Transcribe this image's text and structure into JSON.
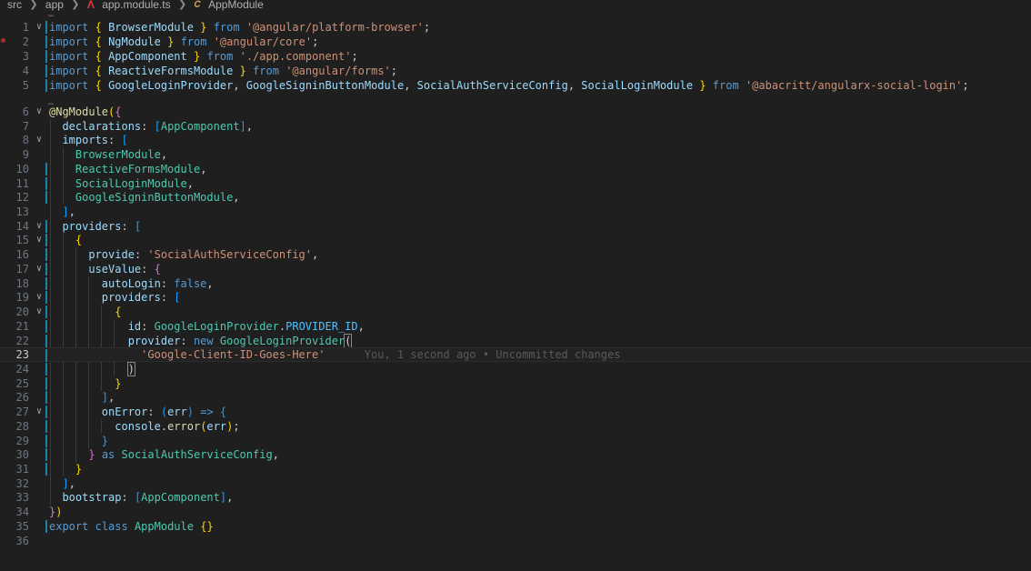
{
  "breadcrumb": {
    "segments": [
      "src",
      "app",
      "app.module.ts",
      "AppModule"
    ],
    "icons": [
      "angular-icon",
      "symbol-class-icon"
    ]
  },
  "editor": {
    "current_line": 23,
    "blame": "You, 1 second ago • Uncommitted changes",
    "lines": [
      {
        "n": 1,
        "fold": true,
        "mod": true,
        "tokens": [
          [
            "kw",
            "import"
          ],
          [
            "pun",
            " "
          ],
          [
            "br1",
            "{"
          ],
          [
            "pun",
            " "
          ],
          [
            "var",
            "BrowserModule"
          ],
          [
            "pun",
            " "
          ],
          [
            "br1",
            "}"
          ],
          [
            "pun",
            " "
          ],
          [
            "kw",
            "from"
          ],
          [
            "pun",
            " "
          ],
          [
            "str",
            "'@angular/platform-browser'"
          ],
          [
            "pun",
            ";"
          ]
        ]
      },
      {
        "n": 2,
        "fold": false,
        "mod": true,
        "tokens": [
          [
            "kw",
            "import"
          ],
          [
            "pun",
            " "
          ],
          [
            "br1",
            "{"
          ],
          [
            "pun",
            " "
          ],
          [
            "var",
            "NgModule"
          ],
          [
            "pun",
            " "
          ],
          [
            "br1",
            "}"
          ],
          [
            "pun",
            " "
          ],
          [
            "kw",
            "from"
          ],
          [
            "pun",
            " "
          ],
          [
            "str",
            "'@angular/core'"
          ],
          [
            "pun",
            ";"
          ]
        ]
      },
      {
        "n": 3,
        "fold": false,
        "mod": true,
        "tokens": [
          [
            "kw",
            "import"
          ],
          [
            "pun",
            " "
          ],
          [
            "br1",
            "{"
          ],
          [
            "pun",
            " "
          ],
          [
            "var",
            "AppComponent"
          ],
          [
            "pun",
            " "
          ],
          [
            "br1",
            "}"
          ],
          [
            "pun",
            " "
          ],
          [
            "kw",
            "from"
          ],
          [
            "pun",
            " "
          ],
          [
            "str",
            "'./app.component'"
          ],
          [
            "pun",
            ";"
          ]
        ]
      },
      {
        "n": 4,
        "fold": false,
        "mod": true,
        "tokens": [
          [
            "kw",
            "import"
          ],
          [
            "pun",
            " "
          ],
          [
            "br1",
            "{"
          ],
          [
            "pun",
            " "
          ],
          [
            "var",
            "ReactiveFormsModule"
          ],
          [
            "pun",
            " "
          ],
          [
            "br1",
            "}"
          ],
          [
            "pun",
            " "
          ],
          [
            "kw",
            "from"
          ],
          [
            "pun",
            " "
          ],
          [
            "str",
            "'@angular/forms'"
          ],
          [
            "pun",
            ";"
          ]
        ]
      },
      {
        "n": 5,
        "fold": false,
        "mod": true,
        "tokens": [
          [
            "kw",
            "import"
          ],
          [
            "pun",
            " "
          ],
          [
            "br1",
            "{"
          ],
          [
            "pun",
            " "
          ],
          [
            "var",
            "GoogleLoginProvider"
          ],
          [
            "pun",
            ", "
          ],
          [
            "var",
            "GoogleSigninButtonModule"
          ],
          [
            "pun",
            ", "
          ],
          [
            "var",
            "SocialAuthServiceConfig"
          ],
          [
            "pun",
            ", "
          ],
          [
            "var",
            "SocialLoginModule"
          ],
          [
            "pun",
            " "
          ],
          [
            "br1",
            "}"
          ],
          [
            "pun",
            " "
          ],
          [
            "kw",
            "from"
          ],
          [
            "pun",
            " "
          ],
          [
            "str",
            "'@abacritt/angularx-social-login'"
          ],
          [
            "pun",
            ";"
          ]
        ]
      },
      {
        "n": 6,
        "fold": true,
        "mod": false,
        "tokens": [
          [
            "fn",
            "@NgModule"
          ],
          [
            "br1",
            "("
          ],
          [
            "br2",
            "{"
          ]
        ]
      },
      {
        "n": 7,
        "fold": false,
        "mod": false,
        "tokens": [
          [
            "pun",
            "  "
          ],
          [
            "var",
            "declarations"
          ],
          [
            "pun",
            ": "
          ],
          [
            "br3",
            "["
          ],
          [
            "type",
            "AppComponent"
          ],
          [
            "br3",
            "]"
          ],
          [
            "pun",
            ","
          ]
        ]
      },
      {
        "n": 8,
        "fold": true,
        "mod": false,
        "tokens": [
          [
            "pun",
            "  "
          ],
          [
            "var",
            "imports"
          ],
          [
            "pun",
            ": "
          ],
          [
            "br3",
            "["
          ]
        ]
      },
      {
        "n": 9,
        "fold": false,
        "mod": false,
        "tokens": [
          [
            "pun",
            "    "
          ],
          [
            "type",
            "BrowserModule"
          ],
          [
            "pun",
            ","
          ]
        ]
      },
      {
        "n": 10,
        "fold": false,
        "mod": true,
        "tokens": [
          [
            "pun",
            "    "
          ],
          [
            "type",
            "ReactiveFormsModule"
          ],
          [
            "pun",
            ","
          ]
        ]
      },
      {
        "n": 11,
        "fold": false,
        "mod": true,
        "tokens": [
          [
            "pun",
            "    "
          ],
          [
            "type",
            "SocialLoginModule"
          ],
          [
            "pun",
            ","
          ]
        ]
      },
      {
        "n": 12,
        "fold": false,
        "mod": true,
        "tokens": [
          [
            "pun",
            "    "
          ],
          [
            "type",
            "GoogleSigninButtonModule"
          ],
          [
            "pun",
            ","
          ]
        ]
      },
      {
        "n": 13,
        "fold": false,
        "mod": false,
        "tokens": [
          [
            "pun",
            "  "
          ],
          [
            "br3",
            "]"
          ],
          [
            "pun",
            ","
          ]
        ]
      },
      {
        "n": 14,
        "fold": true,
        "mod": true,
        "tokens": [
          [
            "pun",
            "  "
          ],
          [
            "var",
            "providers"
          ],
          [
            "pun",
            ": "
          ],
          [
            "br3",
            "["
          ]
        ]
      },
      {
        "n": 15,
        "fold": true,
        "mod": true,
        "tokens": [
          [
            "pun",
            "    "
          ],
          [
            "br1",
            "{"
          ]
        ]
      },
      {
        "n": 16,
        "fold": false,
        "mod": true,
        "tokens": [
          [
            "pun",
            "      "
          ],
          [
            "var",
            "provide"
          ],
          [
            "pun",
            ": "
          ],
          [
            "str",
            "'SocialAuthServiceConfig'"
          ],
          [
            "pun",
            ","
          ]
        ]
      },
      {
        "n": 17,
        "fold": true,
        "mod": true,
        "tokens": [
          [
            "pun",
            "      "
          ],
          [
            "var",
            "useValue"
          ],
          [
            "pun",
            ": "
          ],
          [
            "br2",
            "{"
          ]
        ]
      },
      {
        "n": 18,
        "fold": false,
        "mod": true,
        "tokens": [
          [
            "pun",
            "        "
          ],
          [
            "var",
            "autoLogin"
          ],
          [
            "pun",
            ": "
          ],
          [
            "kw",
            "false"
          ],
          [
            "pun",
            ","
          ]
        ]
      },
      {
        "n": 19,
        "fold": true,
        "mod": true,
        "tokens": [
          [
            "pun",
            "        "
          ],
          [
            "var",
            "providers"
          ],
          [
            "pun",
            ": "
          ],
          [
            "br3",
            "["
          ]
        ]
      },
      {
        "n": 20,
        "fold": true,
        "mod": true,
        "tokens": [
          [
            "pun",
            "          "
          ],
          [
            "br1",
            "{"
          ]
        ]
      },
      {
        "n": 21,
        "fold": false,
        "mod": true,
        "tokens": [
          [
            "pun",
            "            "
          ],
          [
            "var",
            "id"
          ],
          [
            "pun",
            ": "
          ],
          [
            "type",
            "GoogleLoginProvider"
          ],
          [
            "pun",
            "."
          ],
          [
            "const",
            "PROVIDER_ID"
          ],
          [
            "pun",
            ","
          ]
        ]
      },
      {
        "n": 22,
        "fold": false,
        "mod": true,
        "tokens": [
          [
            "pun",
            "            "
          ],
          [
            "var",
            "provider"
          ],
          [
            "pun",
            ": "
          ],
          [
            "kw",
            "new"
          ],
          [
            "pun",
            " "
          ],
          [
            "type",
            "GoogleLoginProvider"
          ],
          [
            "box",
            "("
          ]
        ]
      },
      {
        "n": 23,
        "fold": false,
        "mod": true,
        "tokens": [
          [
            "pun",
            "              "
          ],
          [
            "str",
            "'Google-Client-ID-Goes-Here'"
          ]
        ]
      },
      {
        "n": 24,
        "fold": false,
        "mod": true,
        "tokens": [
          [
            "pun",
            "            "
          ],
          [
            "box",
            ")"
          ]
        ]
      },
      {
        "n": 25,
        "fold": false,
        "mod": true,
        "tokens": [
          [
            "pun",
            "          "
          ],
          [
            "br1",
            "}"
          ]
        ]
      },
      {
        "n": 26,
        "fold": false,
        "mod": true,
        "tokens": [
          [
            "pun",
            "        "
          ],
          [
            "br3",
            "]"
          ],
          [
            "pun",
            ","
          ]
        ]
      },
      {
        "n": 27,
        "fold": true,
        "mod": true,
        "tokens": [
          [
            "pun",
            "        "
          ],
          [
            "var",
            "onError"
          ],
          [
            "pun",
            ": "
          ],
          [
            "br3",
            "("
          ],
          [
            "var",
            "err"
          ],
          [
            "br3",
            ")"
          ],
          [
            "pun",
            " "
          ],
          [
            "kw",
            "=>"
          ],
          [
            "pun",
            " "
          ],
          [
            "br3",
            "{"
          ]
        ]
      },
      {
        "n": 28,
        "fold": false,
        "mod": true,
        "tokens": [
          [
            "pun",
            "          "
          ],
          [
            "var",
            "console"
          ],
          [
            "pun",
            "."
          ],
          [
            "fn",
            "error"
          ],
          [
            "br1",
            "("
          ],
          [
            "var",
            "err"
          ],
          [
            "br1",
            ")"
          ],
          [
            "pun",
            ";"
          ]
        ]
      },
      {
        "n": 29,
        "fold": false,
        "mod": true,
        "tokens": [
          [
            "pun",
            "        "
          ],
          [
            "br3",
            "}"
          ]
        ]
      },
      {
        "n": 30,
        "fold": false,
        "mod": true,
        "tokens": [
          [
            "pun",
            "      "
          ],
          [
            "br2",
            "}"
          ],
          [
            "pun",
            " "
          ],
          [
            "kw",
            "as"
          ],
          [
            "pun",
            " "
          ],
          [
            "type",
            "SocialAuthServiceConfig"
          ],
          [
            "pun",
            ","
          ]
        ]
      },
      {
        "n": 31,
        "fold": false,
        "mod": true,
        "tokens": [
          [
            "pun",
            "    "
          ],
          [
            "br1",
            "}"
          ]
        ]
      },
      {
        "n": 32,
        "fold": false,
        "mod": false,
        "tokens": [
          [
            "pun",
            "  "
          ],
          [
            "br3",
            "]"
          ],
          [
            "pun",
            ","
          ]
        ]
      },
      {
        "n": 33,
        "fold": false,
        "mod": false,
        "tokens": [
          [
            "pun",
            "  "
          ],
          [
            "var",
            "bootstrap"
          ],
          [
            "pun",
            ": "
          ],
          [
            "br3",
            "["
          ],
          [
            "type",
            "AppComponent"
          ],
          [
            "br3",
            "]"
          ],
          [
            "pun",
            ","
          ]
        ]
      },
      {
        "n": 34,
        "fold": false,
        "mod": false,
        "tokens": [
          [
            "br2",
            "}"
          ],
          [
            "br1",
            ")"
          ]
        ]
      },
      {
        "n": 35,
        "fold": false,
        "mod": true,
        "tokens": [
          [
            "kw",
            "export"
          ],
          [
            "pun",
            " "
          ],
          [
            "kw",
            "class"
          ],
          [
            "pun",
            " "
          ],
          [
            "type",
            "AppModule"
          ],
          [
            "pun",
            " "
          ],
          [
            "br1",
            "{}"
          ]
        ]
      },
      {
        "n": 36,
        "fold": false,
        "mod": false,
        "tokens": []
      }
    ]
  }
}
